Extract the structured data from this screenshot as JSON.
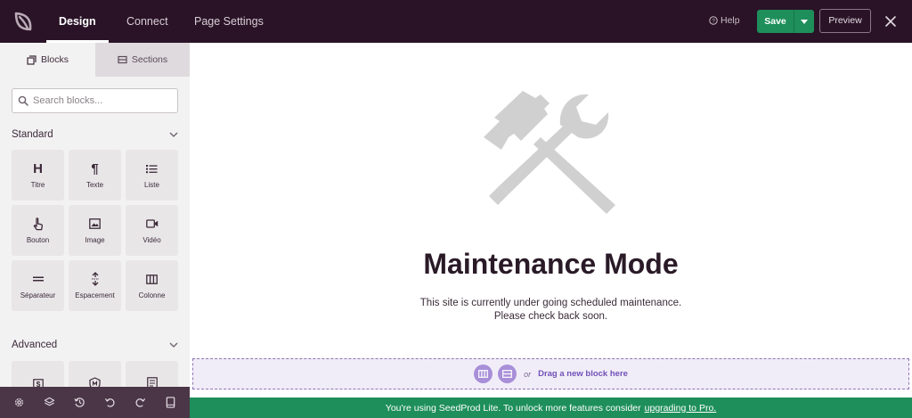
{
  "topbar": {
    "logo_icon": "seedprod-leaf-icon",
    "tabs": [
      {
        "label": "Design",
        "active": true
      },
      {
        "label": "Connect",
        "active": false
      },
      {
        "label": "Page Settings",
        "active": false
      }
    ],
    "help_label": "Help",
    "save_label": "Save",
    "preview_label": "Preview"
  },
  "sidebar": {
    "tabs": [
      {
        "label": "Blocks",
        "icon": "blocks-icon",
        "active": true
      },
      {
        "label": "Sections",
        "icon": "sections-icon",
        "active": false
      }
    ],
    "search_placeholder": "Search blocks...",
    "groups": [
      {
        "title": "Standard",
        "blocks": [
          {
            "label": "Titre",
            "icon": "heading-icon"
          },
          {
            "label": "Texte",
            "icon": "paragraph-icon"
          },
          {
            "label": "Liste",
            "icon": "list-icon"
          },
          {
            "label": "Bouton",
            "icon": "pointer-icon"
          },
          {
            "label": "Image",
            "icon": "image-icon"
          },
          {
            "label": "Vidéo",
            "icon": "video-icon"
          },
          {
            "label": "Séparateur",
            "icon": "divider-icon"
          },
          {
            "label": "Espacement",
            "icon": "spacer-icon"
          },
          {
            "label": "Colonne",
            "icon": "columns-icon"
          }
        ]
      },
      {
        "title": "Advanced",
        "blocks": [
          {
            "label": "",
            "icon": "dollar-icon"
          },
          {
            "label": "",
            "icon": "shield-icon"
          },
          {
            "label": "",
            "icon": "form-icon"
          }
        ]
      }
    ]
  },
  "toolbar": {
    "items": [
      "settings-icon",
      "layers-icon",
      "history-icon",
      "undo-icon",
      "redo-icon",
      "device-preview-icon"
    ]
  },
  "canvas": {
    "title": "Maintenance Mode",
    "message_line1": "This site is currently under going scheduled maintenance.",
    "message_line2": "Please check back soon.",
    "dropzone_or": "or",
    "dropzone_text": "Drag a new block here"
  },
  "promo": {
    "text": "You're using SeedProd Lite. To unlock more features consider",
    "link": "upgrading to Pro."
  },
  "colors": {
    "topbar": "#2a1327",
    "accent_green": "#1e8f5b",
    "dropzone_purple": "#7150b8"
  }
}
